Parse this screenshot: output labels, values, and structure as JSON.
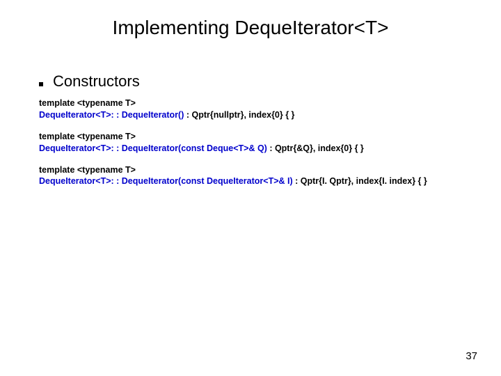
{
  "title": "Implementing DequeIterator<T>",
  "bullet": "Constructors",
  "blocks": [
    {
      "l1": "template <typename T>",
      "sig": "DequeIterator<T>: : DequeIterator()",
      "rest": " : Qptr{nullptr}, index{0} { }"
    },
    {
      "l1": "template <typename T>",
      "sig": "DequeIterator<T>: : DequeIterator(const Deque<T>& Q)",
      "rest": " : Qptr{&Q}, index{0} { }"
    },
    {
      "l1": "template <typename T>",
      "sig": "DequeIterator<T>: : DequeIterator(const DequeIterator<T>& I)",
      "rest": " : Qptr{I. Qptr}, index{I. index} { }"
    }
  ],
  "pagenum": "37"
}
